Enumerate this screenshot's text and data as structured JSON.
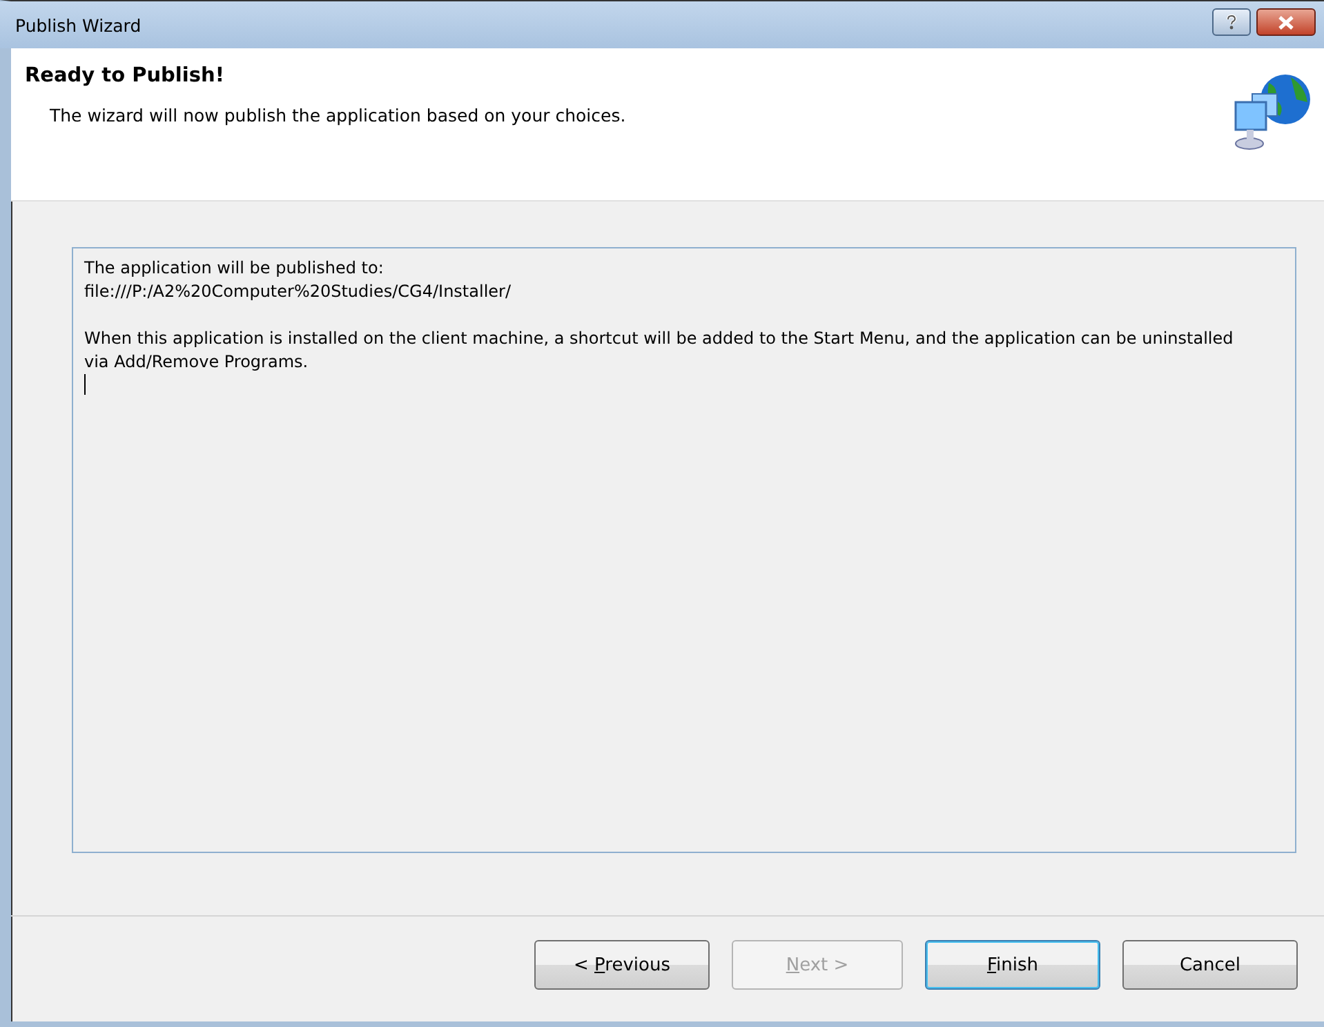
{
  "window": {
    "title": "Publish Wizard"
  },
  "header": {
    "title": "Ready to Publish!",
    "subtitle": "The wizard will now publish the application based on your choices."
  },
  "summary": {
    "lines": [
      "The application will be published to:",
      "file:///P:/A2%20Computer%20Studies/CG4/Installer/",
      "When this application is installed on the client machine, a shortcut will be added to the Start Menu, and the application can be uninstalled via Add/Remove Programs."
    ]
  },
  "buttons": [
    {
      "before": "< ",
      "key": "P",
      "after": "revious",
      "disabled": false,
      "default": false
    },
    {
      "key": "N",
      "after": "ext >",
      "disabled": true,
      "default": false
    },
    {
      "key": "F",
      "after": "inish",
      "disabled": false,
      "default": true
    },
    {
      "after": "Cancel",
      "disabled": false,
      "default": false
    }
  ]
}
